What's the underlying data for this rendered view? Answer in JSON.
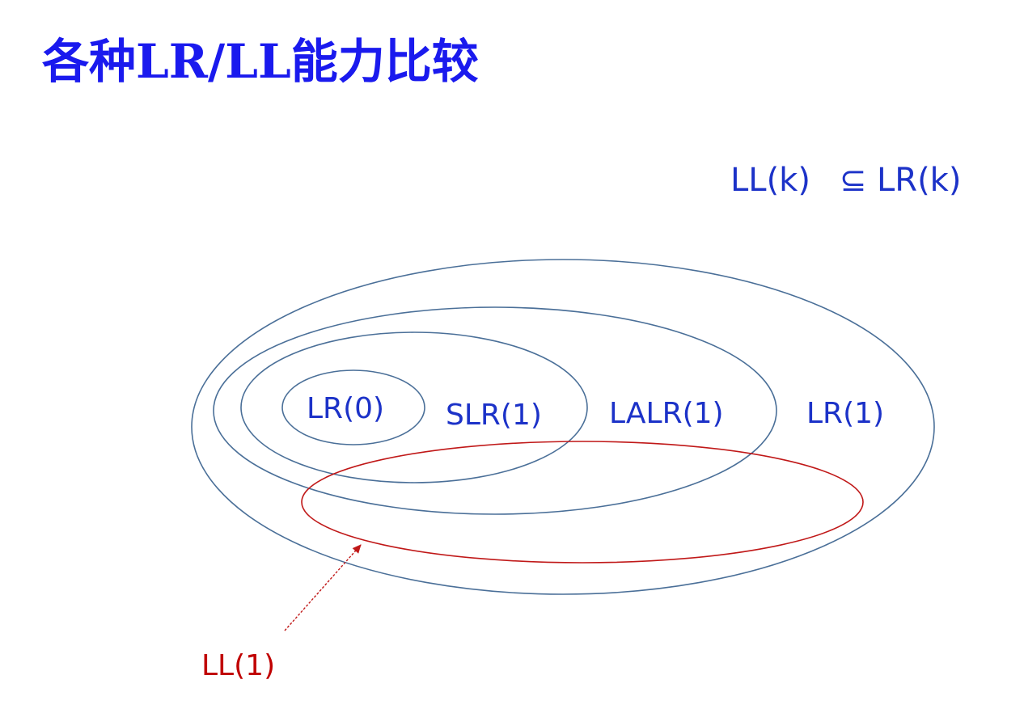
{
  "title": "各种LR/LL能力比较",
  "relation": {
    "left": "LL(k)",
    "symbol": "⊆",
    "right": "LR(k)"
  },
  "sets": [
    {
      "id": "lr0",
      "label": "LR(0)"
    },
    {
      "id": "slr1",
      "label": "SLR(1)"
    },
    {
      "id": "lalr1",
      "label": "LALR(1)"
    },
    {
      "id": "lr1",
      "label": "LR(1)"
    },
    {
      "id": "ll1",
      "label": "LL(1)"
    }
  ],
  "colors": {
    "title_text": "#1a1aee",
    "label_text": "#1c32c8",
    "set_outline": "#4a6f98",
    "ll_outline": "#c01818",
    "ll_text": "#c00000"
  }
}
